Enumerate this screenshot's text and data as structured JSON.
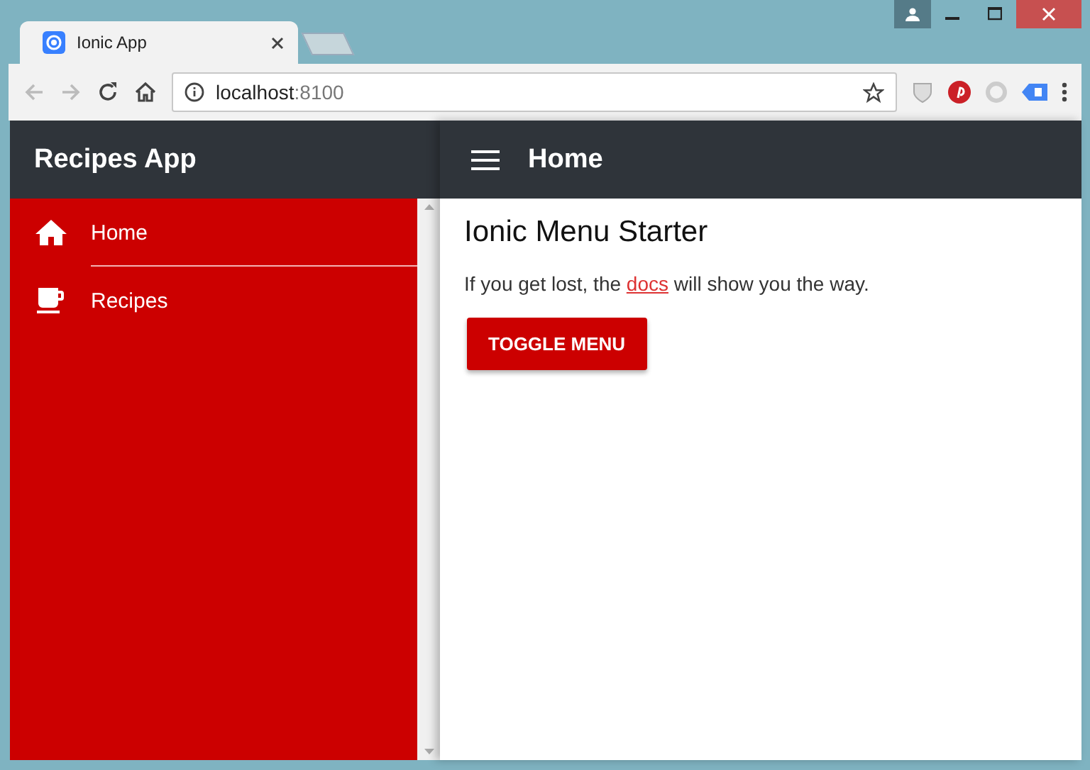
{
  "browser": {
    "tab": {
      "title": "Ionic App"
    },
    "address": {
      "host": "localhost",
      "port": ":8100"
    }
  },
  "menu": {
    "title": "Recipes App",
    "items": [
      {
        "label": "Home",
        "kind": "home"
      },
      {
        "label": "Recipes",
        "kind": "cup"
      }
    ]
  },
  "header": {
    "title": "Home"
  },
  "content": {
    "heading": "Ionic Menu Starter",
    "paragraph": {
      "before": "If you get lost, the ",
      "link": "docs",
      "after": " will show you the way."
    },
    "button": "TOGGLE MENU"
  }
}
